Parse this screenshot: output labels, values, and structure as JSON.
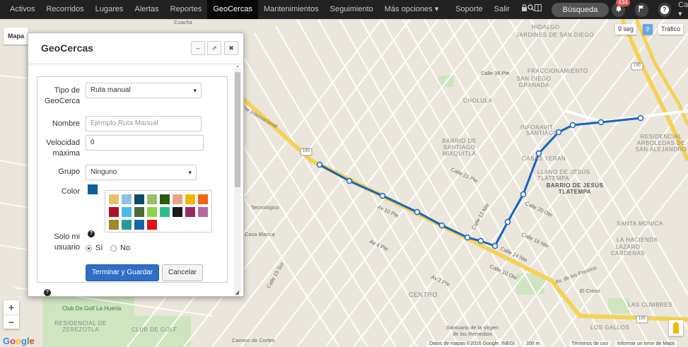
{
  "navbar": {
    "items": [
      {
        "label": "Activos",
        "active": false
      },
      {
        "label": "Recorridos",
        "active": false
      },
      {
        "label": "Lugares",
        "active": false
      },
      {
        "label": "Alertas",
        "active": false
      },
      {
        "label": "Reportes",
        "active": false
      },
      {
        "label": "GeoCercas",
        "active": true
      },
      {
        "label": "Mantenimientos",
        "active": false
      },
      {
        "label": "Seguimiento",
        "active": false
      },
      {
        "label": "Más opciones ▾",
        "active": false
      },
      {
        "label": "Soporte",
        "active": false
      },
      {
        "label": "Salir",
        "active": false
      }
    ],
    "busqueda_label": "Búsqueda",
    "notification_count": "634",
    "user_menu_label": "Cartografía ▾"
  },
  "map": {
    "map_type_tab": "Mapa",
    "refresh_label": "9 seg",
    "traffic_label": "Tráfico",
    "attribution": "Datos de mapas ©2016 Google, INEGI",
    "scale_label": "200 m",
    "terms_label": "Términos de uso",
    "report_label": "Informar un error de Maps",
    "google_logo": "Google",
    "route_color": "#1565c0",
    "labels": {
      "hidalgo": "HIDALGO",
      "jardines": "JARDINES DE SAN DIEGO",
      "fraccionamiento": "FRACCIONAMIENTO",
      "santiago": "SANTIAGO",
      "santiago_mixquitla": "BARRIO DE SANTIAGO MIXQUITLA",
      "san_diego_granada": "SAN DIEGO GRANADA",
      "cholula": "CHOLULA",
      "infonavit": "INFONAVIT",
      "casas_yeran": "CASAS YERAN",
      "llano_jesus": "LLANO DE JESÚS TLATEMPA",
      "barrio_jesus": "BARRIO DE JESÚS TLATEMPA",
      "centro": "CENTRO",
      "residencial_arboledas": "RESIDENCIAL ARBOLEDAS DE SAN ALEJANDRO",
      "la_hacienda": "LA HACIENDA",
      "cardenas": "LAZARO CÁRDENAS",
      "cumbres": "LAS CUMBRES",
      "gallos": "LOS GALLOS",
      "santa_monica": "SANTA MONICA",
      "golf": "Club De Golf La Huerta",
      "zerezotla": "RESIDENCIAL DE ZEREZOTLA",
      "club_golf": "CLUB DE GOLF",
      "santuario": "Santuario de la Virgen de los Remedios",
      "camino_cortes": "Camino de Cortes",
      "casa_blanca": "Casa Blanca",
      "tecnologico": "Tecnológico",
      "periferico": "Per Internacional",
      "calle_12_nte": "Calle 12 Nte",
      "calle_14_nte": "Calle 14 Nte",
      "calle_16_nte": "Calle 16 Nte",
      "calle_20_ote": "Calle 20 Ote",
      "calle_22_pte": "Calle 22 Pte",
      "av_10_pte": "Av 10 Pte",
      "av_2_pte": "Av 2 Pte",
      "av_4_pte": "Av 4 Pte",
      "calle_10_ote": "Calle 10 Ote",
      "av_fresnos": "Av. de los Fresnos",
      "el_cristo": "El Cristo",
      "calle_15_sur": "Calle 15 Sur",
      "calle_36_pte": "Calle 36 Pte",
      "cuacha": "Cuacha",
      "road_190": "190"
    }
  },
  "dialog": {
    "title": "GeoCercas",
    "tool_minimize": "–",
    "tool_popout": "⇗",
    "tool_close": "✖",
    "tipo_label": "Tipo de GeoCerca",
    "tipo_value": "Ruta manual",
    "nombre_label": "Nombre",
    "nombre_placeholder": "Ejemplo Ruta Manual",
    "velocidad_label": "Velocidad máxima",
    "velocidad_value": "0",
    "grupo_label": "Grupo",
    "grupo_value": "Ninguno",
    "color_label": "Color",
    "selected_color": "#0b5e97",
    "palette": [
      "#e6c36b",
      "#8fc1e3",
      "#0e4a6b",
      "#93c06b",
      "#2a5a0c",
      "#e3a48a",
      "#f4b400",
      "#f06414",
      "#b0122a",
      "#49bce8",
      "#4a6b32",
      "#8bd44a",
      "#2bc08a",
      "#1a1a1a",
      "#9c2a5c",
      "#b06aa0",
      "#a08a28",
      "#2a9a98",
      "#1a64a8",
      "#e41010"
    ],
    "solo_label": "Solo mi usuario",
    "si_label": "Sí",
    "no_label": "No",
    "save_label": "Terminar y Guardar",
    "cancel_label": "Cancelar"
  }
}
